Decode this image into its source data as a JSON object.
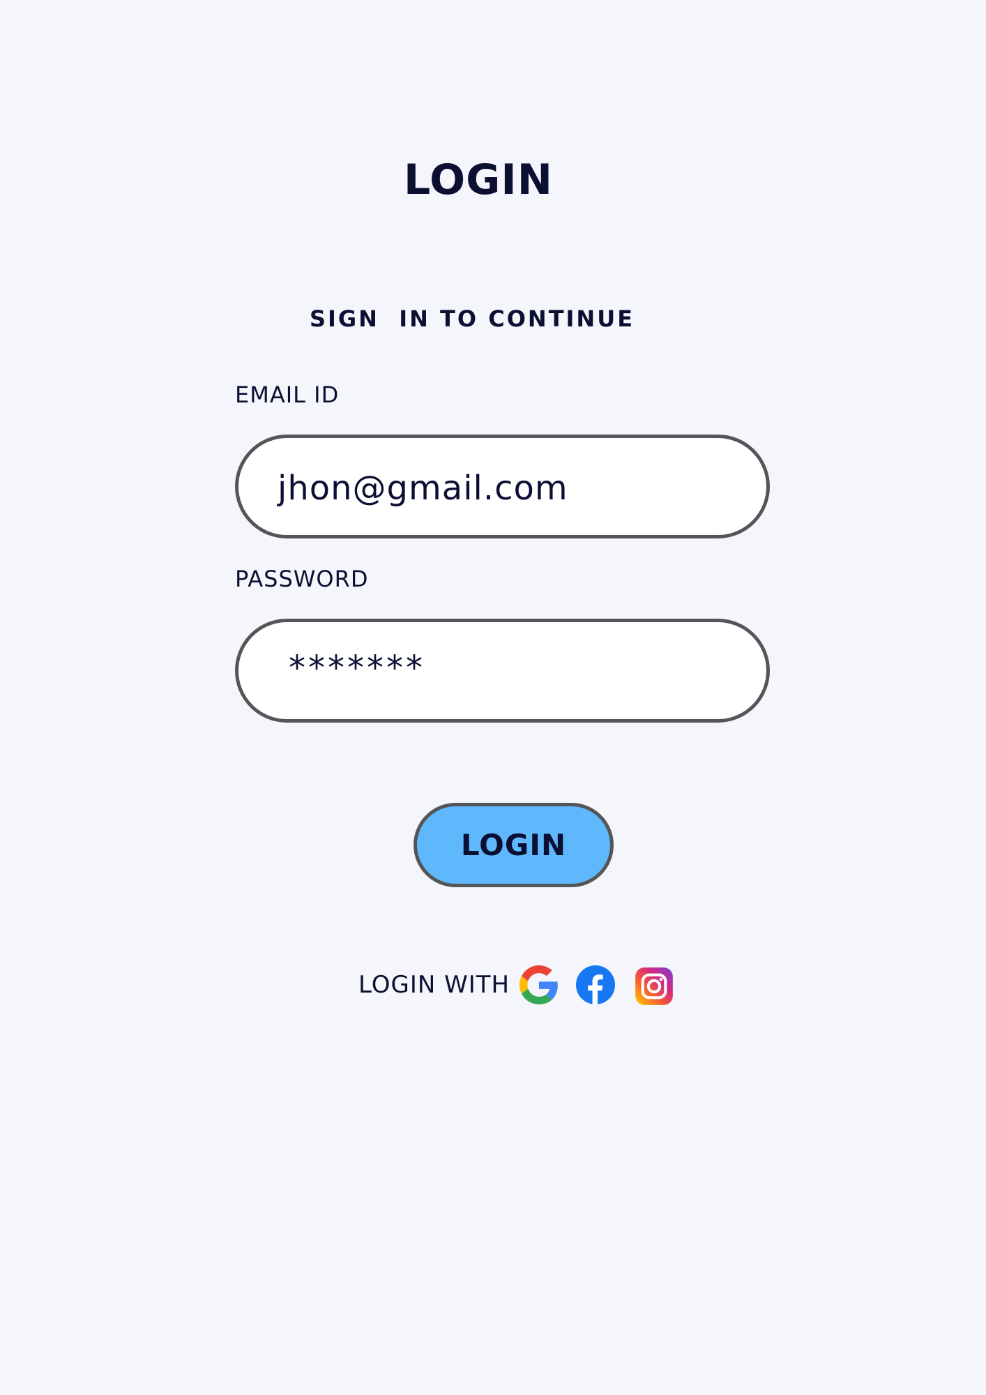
{
  "header": {
    "title": "LOGIN",
    "subtitle": "SIGN  IN TO CONTINUE"
  },
  "form": {
    "email": {
      "label": "EMAIL ID",
      "value": "jhon@gmail.com"
    },
    "password": {
      "label": "PASSWORD",
      "value": "*******"
    },
    "submit_label": "LOGIN"
  },
  "social": {
    "label": "LOGIN WITH",
    "providers": [
      {
        "name": "google-icon"
      },
      {
        "name": "facebook-icon"
      },
      {
        "name": "instagram-icon"
      }
    ]
  },
  "colors": {
    "background": "#f4f6fb",
    "text": "#0b1033",
    "button_fill": "#5fb8fb",
    "border": "#545557"
  }
}
